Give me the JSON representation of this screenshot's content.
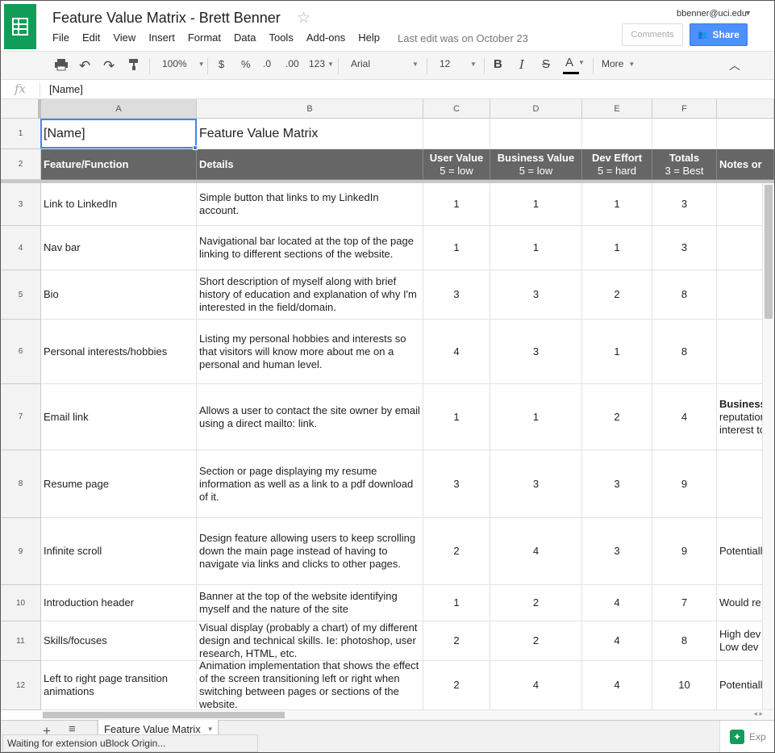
{
  "header": {
    "title": "Feature Value Matrix - Brett Benner",
    "menu": [
      "File",
      "Edit",
      "View",
      "Insert",
      "Format",
      "Data",
      "Tools",
      "Add-ons",
      "Help"
    ],
    "last_edit": "Last edit was on October 23",
    "account": "bbenner@uci.edu",
    "comments_label": "Comments",
    "share_label": "Share"
  },
  "toolbar": {
    "zoom": "100%",
    "currency": "$",
    "percent": "%",
    "decrease_decimal": ".0",
    "increase_decimal": ".00",
    "number_format": "123",
    "font": "Arial",
    "font_size": "12",
    "bold": "B",
    "italic": "I",
    "strike": "S",
    "text_color": "A",
    "more": "More"
  },
  "formula_bar": {
    "fx": "fx",
    "value": "[Name]"
  },
  "columns": [
    "A",
    "B",
    "C",
    "D",
    "E",
    "F"
  ],
  "row_numbers": [
    "1",
    "2",
    "3",
    "4",
    "5",
    "6",
    "7",
    "8",
    "9",
    "10",
    "11",
    "12"
  ],
  "sheet": {
    "row1": {
      "a": "[Name]",
      "b": "Feature Value Matrix"
    },
    "headers": {
      "a": "Feature/Function",
      "b": "Details",
      "c1": "User Value",
      "c2": "5 = low",
      "d1": "Business Value",
      "d2": "5 = low",
      "e1": "Dev Effort",
      "e2": "5 = hard",
      "f1": "Totals",
      "f2": "3 = Best",
      "g": "Notes or"
    },
    "rows": [
      {
        "feature": "Link to LinkedIn",
        "details": "Simple button that links to my LinkedIn account.",
        "user": "1",
        "business": "1",
        "effort": "1",
        "total": "3",
        "notes": ""
      },
      {
        "feature": "Nav bar",
        "details": "Navigational bar located at the top of the page linking to different sections of the website.",
        "user": "1",
        "business": "1",
        "effort": "1",
        "total": "3",
        "notes": ""
      },
      {
        "feature": "Bio",
        "details": "Short description of myself along with brief history of education and explanation of why I'm interested in the field/domain.",
        "user": "3",
        "business": "3",
        "effort": "2",
        "total": "8",
        "notes": ""
      },
      {
        "feature": "Personal interests/hobbies",
        "details": "Listing my personal hobbies and interests so that visitors will know more about me on a personal and human level.",
        "user": "4",
        "business": "3",
        "effort": "1",
        "total": "8",
        "notes": ""
      },
      {
        "feature": "Email link",
        "details": "Allows a user to contact the site owner by email using a direct mailto: link.",
        "user": "1",
        "business": "1",
        "effort": "2",
        "total": "4",
        "notes_bold": "Business",
        "notes_line2": "reputation",
        "notes_line3": "interest to"
      },
      {
        "feature": "Resume page",
        "details": "Section or page displaying my resume information as well as a link to a pdf download of it.",
        "user": "3",
        "business": "3",
        "effort": "3",
        "total": "9",
        "notes": ""
      },
      {
        "feature": "Infinite scroll",
        "details": "Design feature allowing users to keep scrolling down the main page instead of having to navigate via links and clicks to other pages.",
        "user": "2",
        "business": "4",
        "effort": "3",
        "total": "9",
        "notes": "Potentiall"
      },
      {
        "feature": "Introduction header",
        "details": "Banner at the top of the website identifying myself and the nature of the site",
        "user": "1",
        "business": "2",
        "effort": "4",
        "total": "7",
        "notes": "Would re"
      },
      {
        "feature": "Skills/focuses",
        "details": "Visual display (probably a chart) of my different design and technical skills. Ie: photoshop, user research, HTML, etc.",
        "user": "2",
        "business": "2",
        "effort": "4",
        "total": "8",
        "notes_line1": "High dev",
        "notes_line2": "Low dev"
      },
      {
        "feature": "Left to right page transition animations",
        "details": "Animation implementation that shows the effect of the screen transitioning left or right when switching between pages or sections of the website.",
        "user": "2",
        "business": "4",
        "effort": "4",
        "total": "10",
        "notes": "Potentiall"
      }
    ]
  },
  "sheet_tab": "Feature Value Matrix",
  "status": "Waiting for extension uBlock Origin...",
  "explore_label": "Exp",
  "colors": {
    "brand_green": "#0f9d58",
    "share_blue": "#4d90fe",
    "header_row_bg": "#666666",
    "selection": "#4285f4"
  },
  "icons": [
    "sheets-logo-icon",
    "star-icon",
    "print-icon",
    "undo-icon",
    "redo-icon",
    "paint-format-icon",
    "collapse-icon",
    "add-sheet-icon",
    "all-sheets-icon",
    "explore-icon"
  ]
}
